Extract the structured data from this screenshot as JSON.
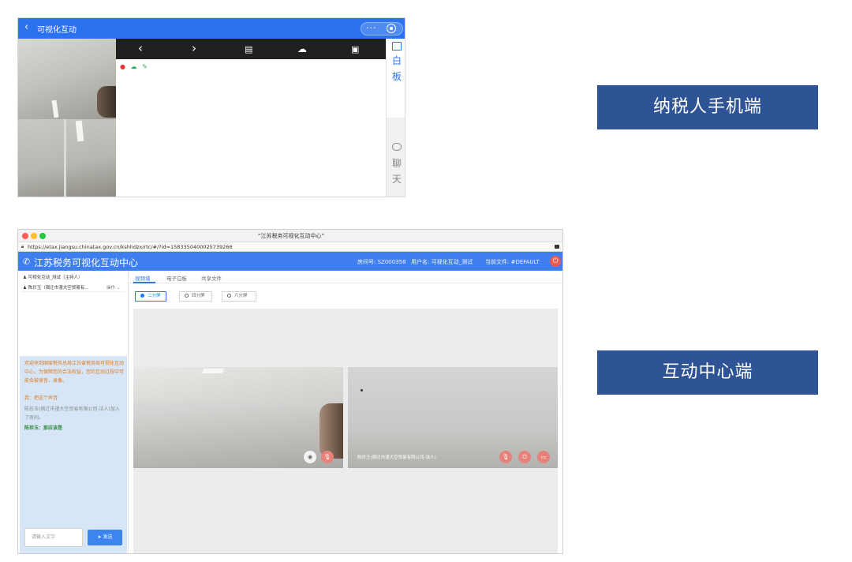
{
  "mobile": {
    "title": "可视化互动",
    "more_icon": "···",
    "toolbar_icons": [
      "chevron-left-icon",
      "chevron-right-icon",
      "document-search-icon",
      "cloud-upload-icon",
      "image-card-icon"
    ],
    "side_tabs": [
      {
        "label_1": "白",
        "label_2": "板",
        "icon": "whiteboard-icon",
        "active": true
      },
      {
        "label_1": "聊",
        "label_2": "天",
        "icon": "chat-icon",
        "active": false
      }
    ],
    "wb_tools": [
      "microphone-icon",
      "cloud-icon",
      "edit-icon"
    ]
  },
  "desktop": {
    "window_title": "“江苏税务可视化互动中心”",
    "url": "https://etax.jiangsu.chinatax.gov.cn/kshhdzx/rtc/#/?id=1583350400025739266",
    "app_title": "江苏税务可视化互动中心",
    "room_label": "房间号: SZ000358",
    "user_label": "用户名: 可视化互动_测试",
    "file_label": "当前文件: #DEFAULT",
    "members": [
      {
        "name": "可视化互动_测试（主持人）"
      },
      {
        "name": "陈珍玉（宿迁市漫大空贸易有...",
        "ops": "操作"
      }
    ],
    "chat": {
      "welcome": "欢迎来到国家税务总局江苏省税务局可视化互动中心，为保障您的合法权益，您的互动过程中可能会被录音、录像。",
      "me": "我：把这个声音",
      "join": "陈珍玉(宿迁市漫大空贸易有限公司-法人)加入了房间。",
      "reply": "陈珍玉：那应该是",
      "input_placeholder": "请输入文字",
      "send_label": "发送"
    },
    "tabs": [
      "视频墙",
      "电子白板",
      "共享文件"
    ],
    "splits": [
      "二分屏",
      "四分屏",
      "六分屏"
    ],
    "video2_label": "陈珍玉(宿迁市漫大空贸易有限公司-法人)"
  },
  "badges": {
    "mobile_label": "纳税人手机端",
    "desktop_label": "互动中心端"
  },
  "colors": {
    "brand_blue": "#2a72ee",
    "badge_blue": "#2f5496",
    "chat_bg": "#d6e6f7",
    "danger": "#e85a4f"
  }
}
